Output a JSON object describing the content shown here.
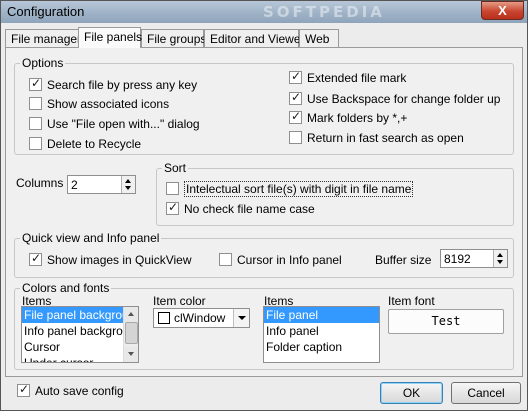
{
  "window": {
    "title": "Configuration",
    "close_glyph": "X",
    "watermark": "SOFTPEDIA"
  },
  "tabs": [
    {
      "label": "File manager",
      "active": false
    },
    {
      "label": "File panels",
      "active": true
    },
    {
      "label": "File groups",
      "active": false
    },
    {
      "label": "Editor and Viewer",
      "active": false
    },
    {
      "label": "Web",
      "active": false
    }
  ],
  "options": {
    "legend": "Options",
    "items": [
      {
        "label": "Search file by press any key",
        "checked": true
      },
      {
        "label": "Show associated icons",
        "checked": false
      },
      {
        "label": "Use \"File open with...\" dialog",
        "checked": false
      },
      {
        "label": "Delete to Recycle",
        "checked": false
      },
      {
        "label": "Extended file mark",
        "checked": true
      },
      {
        "label": "Use Backspace for change folder up",
        "checked": true
      },
      {
        "label": "Mark folders by *,+",
        "checked": true
      },
      {
        "label": "Return in fast search as open",
        "checked": false
      }
    ]
  },
  "columns": {
    "label": "Columns",
    "value": "2"
  },
  "sort": {
    "legend": "Sort",
    "items": [
      {
        "label": "Intelectual sort file(s) with digit in file name",
        "checked": false
      },
      {
        "label": "No check file name case",
        "checked": true
      }
    ]
  },
  "quickview": {
    "legend": "Quick view and Info panel",
    "show_images": {
      "label": "Show images in QuickView",
      "checked": true
    },
    "cursor_info": {
      "label": "Cursor in Info panel",
      "checked": false
    },
    "buffer_label": "Buffer size",
    "buffer_value": "8192"
  },
  "colors": {
    "legend": "Colors and fonts",
    "items_label": "Items",
    "items": [
      "File panel background",
      "Info panel background",
      "Cursor",
      "Under cursor"
    ],
    "items_selected": 0,
    "item_color_label": "Item color",
    "item_color_value": "clWindow",
    "font_items_label": "Items",
    "font_items": [
      "File panel",
      "Info panel",
      "Folder caption"
    ],
    "font_items_selected": 0,
    "item_font_label": "Item font",
    "test_button": "Test"
  },
  "footer": {
    "auto_save": {
      "label": "Auto save config",
      "checked": true
    },
    "ok": "OK",
    "cancel": "Cancel"
  },
  "colors_theme": {
    "selection": "#3399ff",
    "close": "#c8452f"
  }
}
